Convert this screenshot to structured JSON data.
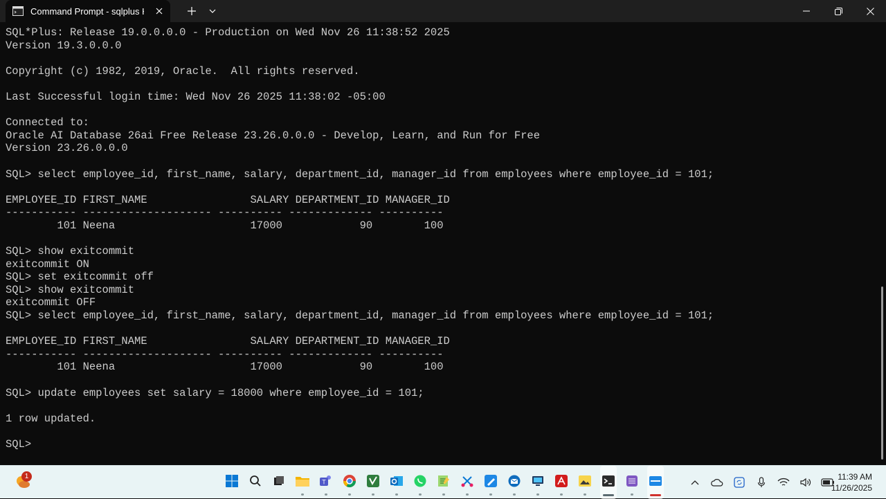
{
  "window": {
    "tab_title": "Command Prompt - sqlplus  H",
    "new_tab_symbol": "+",
    "dropdown_symbol": "⌄"
  },
  "terminal": {
    "lines": [
      "SQL*Plus: Release 19.0.0.0.0 - Production on Wed Nov 26 11:38:52 2025",
      "Version 19.3.0.0.0",
      "",
      "Copyright (c) 1982, 2019, Oracle.  All rights reserved.",
      "",
      "Last Successful login time: Wed Nov 26 2025 11:38:02 -05:00",
      "",
      "Connected to:",
      "Oracle AI Database 26ai Free Release 23.26.0.0.0 - Develop, Learn, and Run for Free",
      "Version 23.26.0.0.0",
      "",
      "SQL> select employee_id, first_name, salary, department_id, manager_id from employees where employee_id = 101;",
      "",
      "EMPLOYEE_ID FIRST_NAME                SALARY DEPARTMENT_ID MANAGER_ID",
      "----------- -------------------- ---------- ------------- ----------",
      "        101 Neena                     17000            90        100",
      "",
      "SQL> show exitcommit",
      "exitcommit ON",
      "SQL> set exitcommit off",
      "SQL> show exitcommit",
      "exitcommit OFF",
      "SQL> select employee_id, first_name, salary, department_id, manager_id from employees where employee_id = 101;",
      "",
      "EMPLOYEE_ID FIRST_NAME                SALARY DEPARTMENT_ID MANAGER_ID",
      "----------- -------------------- ---------- ------------- ----------",
      "        101 Neena                     17000            90        100",
      "",
      "SQL> update employees set salary = 18000 where employee_id = 101;",
      "",
      "1 row updated.",
      "",
      "SQL> "
    ],
    "text_color": "#cccccc",
    "background": "#0c0c0c"
  },
  "taskbar": {
    "weather_badge": "1",
    "apps": [
      "windows-start-icon",
      "search-icon",
      "task-view-icon",
      "file-explorer-icon",
      "teams-icon",
      "chrome-icon",
      "visual-studio-icon",
      "outlook-icon",
      "whatsapp-icon",
      "notepad-plus-plus-icon",
      "snipping-tool-icon",
      "paint-icon",
      "outlook-mail-icon",
      "remote-desktop-icon",
      "acrobat-icon",
      "photos-icon",
      "terminal-icon",
      "dbeaver-icon",
      "sql-developer-icon"
    ],
    "clock_time": "11:39 AM",
    "clock_date": "11/26/2025"
  }
}
